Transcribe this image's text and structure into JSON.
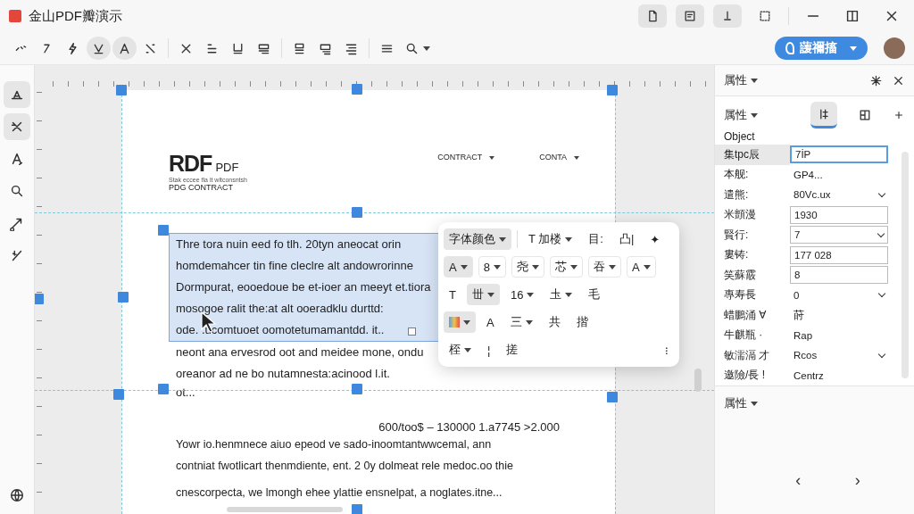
{
  "window": {
    "title": "金山PDF瓣演示"
  },
  "title_actions": [
    {
      "pressed": true
    },
    {
      "pressed": true
    },
    {
      "pressed": true
    },
    {
      "pressed": false
    }
  ],
  "tools": [
    {
      "selected": false
    },
    {
      "selected": false
    },
    {
      "selected": false
    },
    {
      "selected": true
    },
    {
      "selected": true
    },
    {
      "selected": false
    },
    {
      "selected": false
    },
    {
      "selected": false
    },
    {
      "selected": false
    },
    {
      "selected": false
    },
    {
      "selected": false
    },
    {
      "selected": false
    },
    {
      "selected": false
    },
    {
      "selected": false
    },
    {
      "selected": false
    }
  ],
  "help_button": {
    "label": "蘐禰搐"
  },
  "rail": [
    {
      "selected": true
    },
    {
      "selected": true
    },
    {
      "selected": false
    },
    {
      "selected": false
    },
    {
      "selected": false
    },
    {
      "selected": false
    }
  ],
  "document": {
    "logo": "RDF",
    "logo_suffix": "PDF",
    "tagline": "Stak eccee fla lt wltconsntsh",
    "subtitle": "PDG CONTRACT",
    "header_links": [
      "CONTRACT",
      "CONTA"
    ],
    "selected_paragraph": [
      "Thre tora nuin eed fo tlh. 20tyn aneocat orin",
      "homdemahcer tin fine cleclre alt andowrorinne",
      "Dormpurat, eooedoue be et-ioer an meeyt et.tiora",
      "mosogoe ralit the:at alt ooeradklu durttd:",
      "ode. .ucomtuoet oomotetumamantdd. it.."
    ],
    "paragraph_2": [
      "neont ana ervesrod oot and meidee mone, ondu",
      "oreanor ad ne bo nutamnesta:acinood l.it."
    ],
    "fragment": "ot...",
    "amount": "600/too$ – 130000 1.a7745 >2.000",
    "paragraph_3": [
      "Yowr io.henmnece aiuo epeod ve sado-inoomtantwwcemal, ann",
      "contniat fwotlicart thenmdiente, ent. 2 0y dolmeat rele medoc.oo thie"
    ],
    "paragraph_4": "cnescorpecta, we lmongh ehee ylattie ensnelpat, a noglates.itne..."
  },
  "format_toolbar": [
    {
      "items": [
        {
          "kind": "dropdown",
          "label": "字体颜色",
          "selected": true
        },
        {
          "kind": "separator"
        },
        {
          "kind": "dropdown",
          "label": "T 加楼",
          "selected": false
        },
        {
          "kind": "button",
          "label": "目:",
          "selected": false
        },
        {
          "kind": "button",
          "label": "凸|",
          "selected": false
        },
        {
          "kind": "button",
          "label": "✦",
          "selected": false
        }
      ]
    },
    {
      "items": [
        {
          "kind": "boxed_dropdown",
          "label": "A",
          "selected": true
        },
        {
          "kind": "boxed_dropdown",
          "label": "8",
          "selected": false
        },
        {
          "kind": "boxed_dropdown",
          "label": "尧",
          "selected": false
        },
        {
          "kind": "boxed_dropdown",
          "label": "芯",
          "selected": false
        },
        {
          "kind": "boxed_dropdown",
          "label": "吞",
          "selected": false
        },
        {
          "kind": "boxed_dropdown",
          "label": "A",
          "selected": false
        }
      ]
    },
    {
      "items": [
        {
          "kind": "button",
          "label": "T",
          "selected": false
        },
        {
          "kind": "dropdown",
          "label": "丗",
          "selected": true
        },
        {
          "kind": "dropdown",
          "label": "16",
          "selected": false
        },
        {
          "kind": "dropdown",
          "label": "圡",
          "selected": false
        },
        {
          "kind": "button",
          "label": "毛",
          "selected": false
        }
      ]
    },
    {
      "items": [
        {
          "kind": "swatch",
          "selected": true
        },
        {
          "kind": "button",
          "label": "A",
          "selected": false
        },
        {
          "kind": "dropdown",
          "label": "三",
          "selected": false
        },
        {
          "kind": "button",
          "label": "共",
          "selected": false
        },
        {
          "kind": "button",
          "label": "揩",
          "selected": false
        }
      ]
    },
    {
      "items": [
        {
          "kind": "dropdown",
          "label": "桎",
          "selected": false
        },
        {
          "kind": "button",
          "label": "¦",
          "selected": false
        },
        {
          "kind": "button",
          "label": "搓",
          "selected": false
        },
        {
          "kind": "spacer"
        },
        {
          "kind": "button",
          "label": "⁝",
          "selected": false
        }
      ]
    }
  ],
  "panel": {
    "title": "属性",
    "section": "属性",
    "tabs": [
      {
        "selected": true
      },
      {
        "selected": false
      }
    ],
    "object_label": "Object",
    "rows": [
      {
        "label": "集tpc辰",
        "value": "7İP",
        "kind": "input",
        "selected": true
      },
      {
        "label": "本舰:",
        "value": "GP4...",
        "kind": "text",
        "selected": false
      },
      {
        "label": "遣熊:",
        "value": "80Vc.ux",
        "kind": "dropdown",
        "selected": false
      },
      {
        "label": "米顫漫",
        "value": "1930",
        "kind": "input",
        "selected": false
      },
      {
        "label": "賢行:",
        "value": "7",
        "kind": "select",
        "selected": false
      },
      {
        "label": "婁铸:",
        "value": "177 028",
        "kind": "input",
        "selected": false
      },
      {
        "label": "笑蘇霰",
        "value": "8",
        "kind": "input",
        "selected": false
      },
      {
        "label": "專寿長",
        "value": "0",
        "kind": "dropdown",
        "selected": false
      },
      {
        "label": "蜡鵬涌 ∀",
        "value": "莳",
        "kind": "text",
        "selected": false
      },
      {
        "label": "牛麒瓶 ·",
        "value": "Rap",
        "kind": "text",
        "selected": false
      },
      {
        "label": "敏濡滆 才",
        "value": "Rcos",
        "kind": "dropdown",
        "selected": false
      },
      {
        "label": "邀險/長 !",
        "value": "Centrz",
        "kind": "text",
        "selected": false
      }
    ],
    "footer_section": "属性",
    "nav": [
      "‹",
      "›"
    ]
  }
}
